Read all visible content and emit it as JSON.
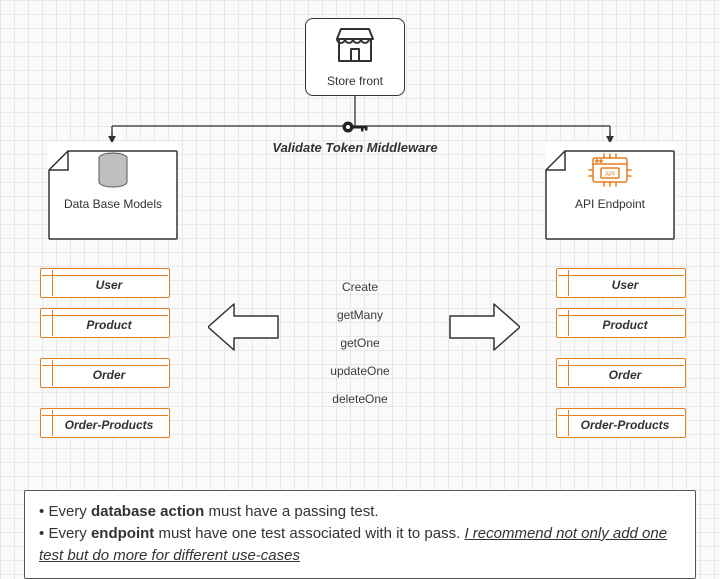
{
  "storefront": {
    "label": "Store front"
  },
  "middleware": {
    "label": "Validate Token Middleware"
  },
  "db": {
    "label": "Data Base Models",
    "entities": [
      "User",
      "Product",
      "Order",
      "Order-Products"
    ]
  },
  "api": {
    "label": "API Endpoint",
    "entities": [
      "User",
      "Product",
      "Order",
      "Order-Products"
    ]
  },
  "operations": [
    "Create",
    "getMany",
    "getOne",
    "updateOne",
    "deleteOne"
  ],
  "notes": {
    "line1_prefix": "Every ",
    "line1_bold": "database action",
    "line1_suffix": " must have a passing test.",
    "line2_prefix": "Every ",
    "line2_bold": "endpoint",
    "line2_mid": " must have one test associated with it to pass. ",
    "line2_underline": "I recommend not only add one test but do more for different use-cases"
  }
}
